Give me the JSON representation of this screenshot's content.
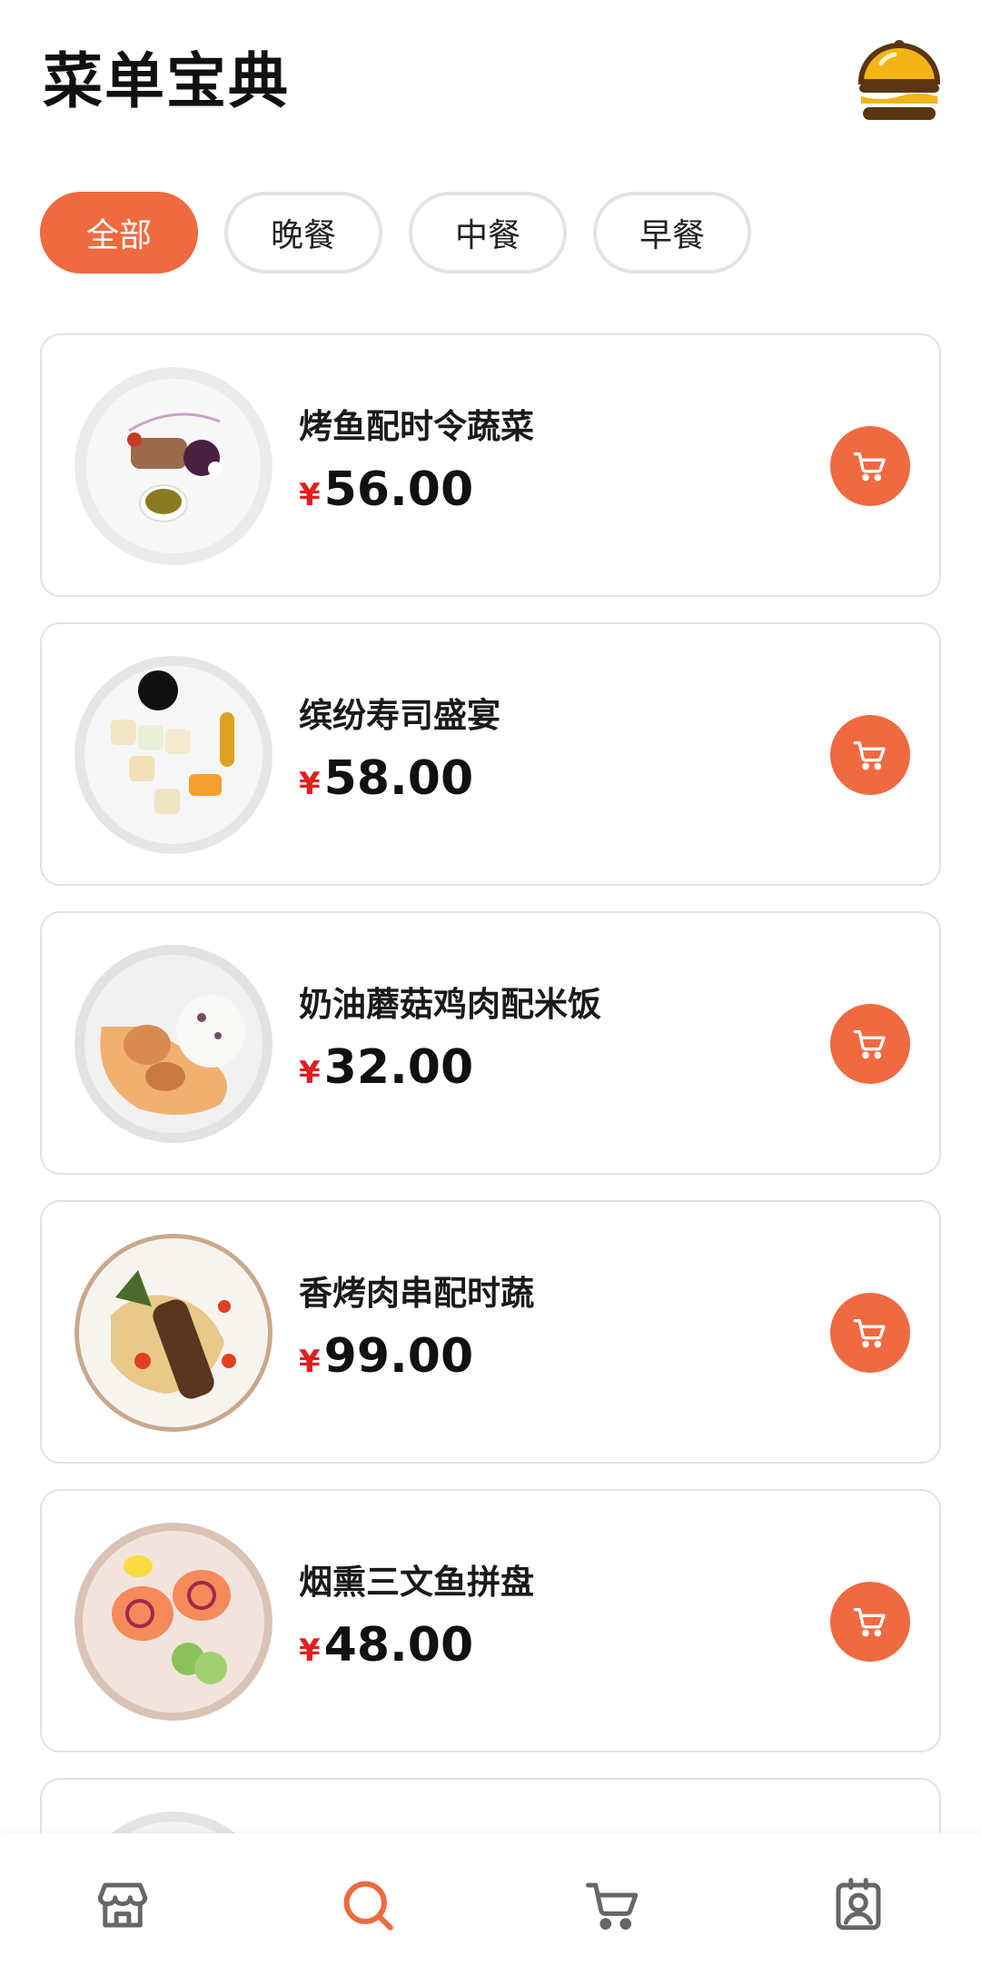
{
  "app": {
    "title": "菜单宝典",
    "logo_icon": "food-cloche-icon"
  },
  "colors": {
    "accent": "#ef6a41",
    "price_symbol": "#e02020",
    "nav_inactive": "#666666"
  },
  "tabs": [
    {
      "label": "全部",
      "active": true
    },
    {
      "label": "晚餐",
      "active": false
    },
    {
      "label": "中餐",
      "active": false
    },
    {
      "label": "早餐",
      "active": false
    }
  ],
  "dishes": [
    {
      "name": "烤鱼配时令蔬菜",
      "currency": "¥",
      "price": "56.00",
      "icon": "cart-icon"
    },
    {
      "name": "缤纷寿司盛宴",
      "currency": "¥",
      "price": "58.00",
      "icon": "cart-icon"
    },
    {
      "name": "奶油蘑菇鸡肉配米饭",
      "currency": "¥",
      "price": "32.00",
      "icon": "cart-icon"
    },
    {
      "name": "香烤肉串配时蔬",
      "currency": "¥",
      "price": "99.00",
      "icon": "cart-icon"
    },
    {
      "name": "烟熏三文鱼拼盘",
      "currency": "¥",
      "price": "48.00",
      "icon": "cart-icon"
    }
  ],
  "bottom_nav": [
    {
      "icon": "store-icon",
      "active": false
    },
    {
      "icon": "search-icon",
      "active": true
    },
    {
      "icon": "cart-icon",
      "active": false
    },
    {
      "icon": "profile-badge-icon",
      "active": false
    }
  ]
}
